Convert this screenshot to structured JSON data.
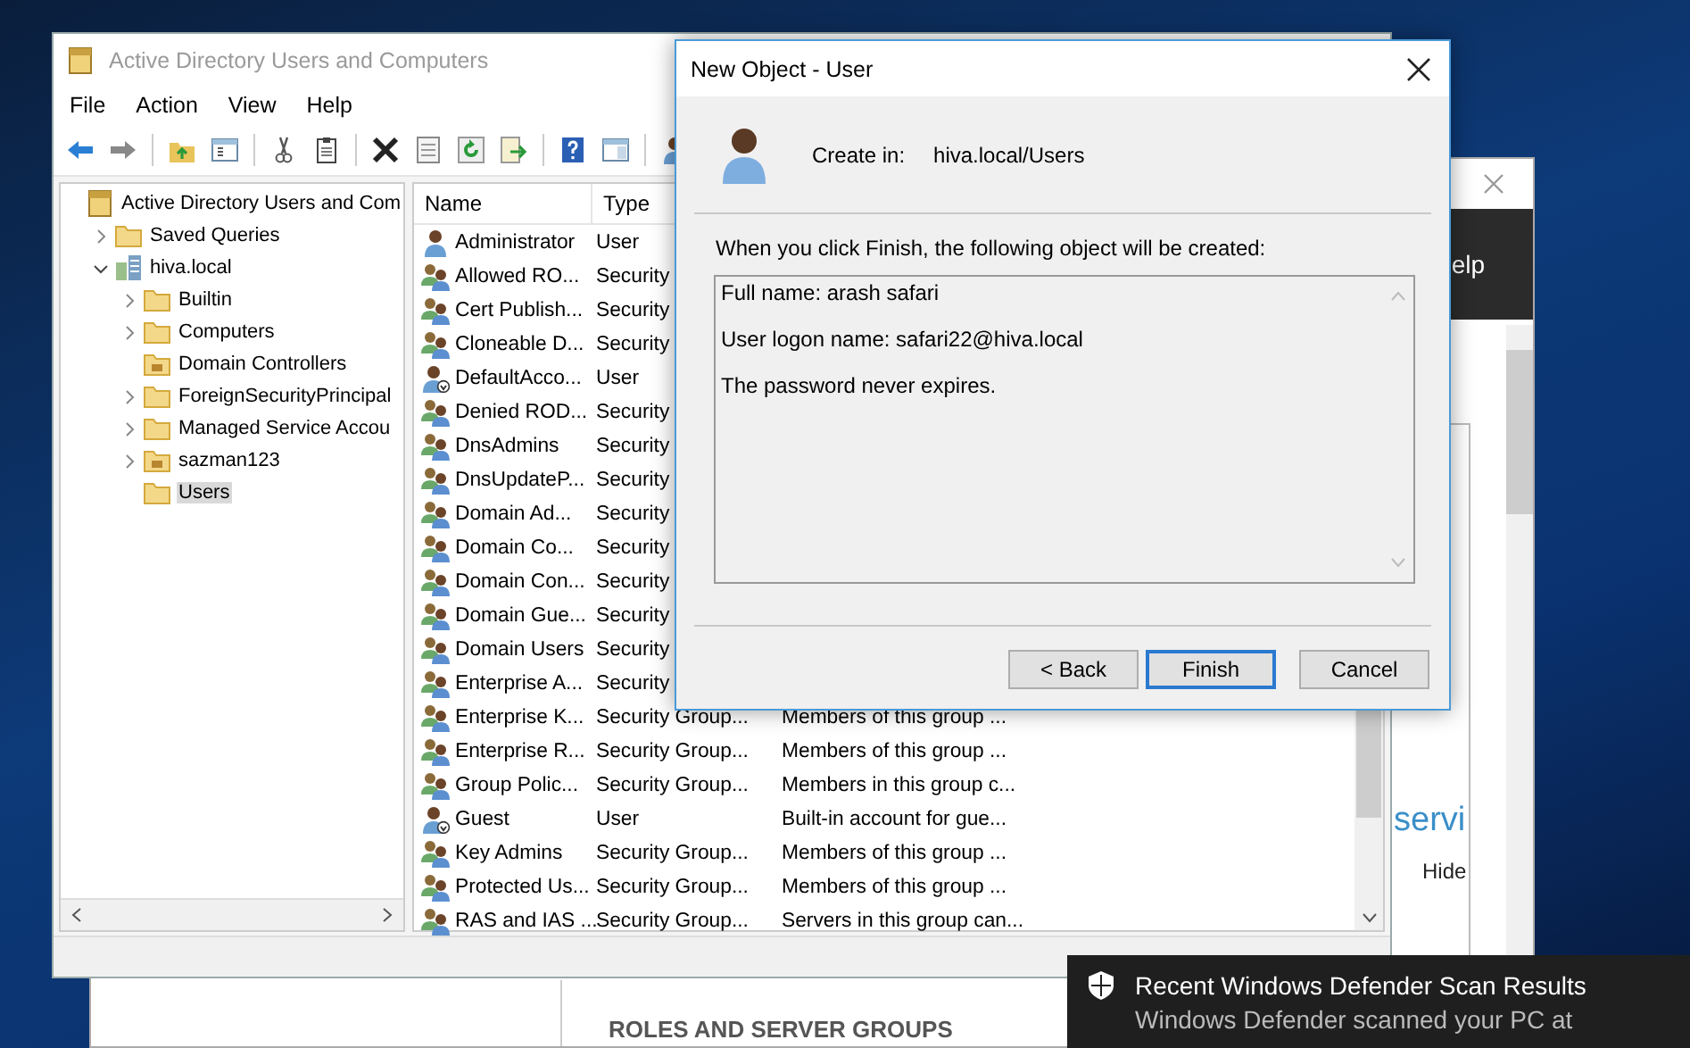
{
  "server_manager": {
    "header_text": "elp",
    "tile_title": "servi",
    "tile_link": "Hide",
    "section_heading": "ROLES AND SERVER GROUPS"
  },
  "main_window": {
    "title": "Active Directory Users and Computers",
    "menu": [
      "File",
      "Action",
      "View",
      "Help"
    ],
    "tree": [
      {
        "label": "Active Directory Users and Com",
        "kind": "snapin",
        "expandable": false,
        "selected": false,
        "children": [
          {
            "label": "Saved Queries",
            "kind": "folder",
            "expandable": true,
            "expanded": false,
            "selected": false
          },
          {
            "label": "hiva.local",
            "kind": "domain",
            "expandable": true,
            "expanded": true,
            "selected": false,
            "children": [
              {
                "label": "Builtin",
                "kind": "folder",
                "expandable": true,
                "expanded": false,
                "selected": false
              },
              {
                "label": "Computers",
                "kind": "folder",
                "expandable": true,
                "expanded": false,
                "selected": false
              },
              {
                "label": "Domain Controllers",
                "kind": "ou",
                "expandable": false,
                "selected": false
              },
              {
                "label": "ForeignSecurityPrincipal",
                "kind": "folder",
                "expandable": true,
                "expanded": false,
                "selected": false
              },
              {
                "label": "Managed Service Accou",
                "kind": "folder",
                "expandable": true,
                "expanded": false,
                "selected": false
              },
              {
                "label": "sazman123",
                "kind": "ou",
                "expandable": true,
                "expanded": false,
                "selected": false
              },
              {
                "label": "Users",
                "kind": "folder",
                "expandable": false,
                "selected": true
              }
            ]
          }
        ]
      }
    ],
    "list": {
      "columns": [
        "Name",
        "Type"
      ],
      "rows": [
        {
          "kind": "user",
          "name": "Administrator",
          "type": "User"
        },
        {
          "kind": "group",
          "name": "Allowed RO...",
          "type": "Security"
        },
        {
          "kind": "group",
          "name": "Cert Publish...",
          "type": "Security"
        },
        {
          "kind": "group",
          "name": "Cloneable D...",
          "type": "Security"
        },
        {
          "kind": "disabled_user",
          "name": "DefaultAcco...",
          "type": "User"
        },
        {
          "kind": "group",
          "name": "Denied ROD...",
          "type": "Security"
        },
        {
          "kind": "group",
          "name": "DnsAdmins",
          "type": "Security"
        },
        {
          "kind": "group",
          "name": "DnsUpdateP...",
          "type": "Security"
        },
        {
          "kind": "group",
          "name": "Domain Ad...",
          "type": "Security"
        },
        {
          "kind": "group",
          "name": "Domain Co...",
          "type": "Security"
        },
        {
          "kind": "group",
          "name": "Domain Con...",
          "type": "Security"
        },
        {
          "kind": "group",
          "name": "Domain Gue...",
          "type": "Security"
        },
        {
          "kind": "group",
          "name": "Domain Users",
          "type": "Security"
        },
        {
          "kind": "group",
          "name": "Enterprise A...",
          "type": "Security"
        },
        {
          "kind": "group",
          "name": "Enterprise K...",
          "type": "Security Group...",
          "description": "Members of this group ..."
        },
        {
          "kind": "group",
          "name": "Enterprise R...",
          "type": "Security Group...",
          "description": "Members of this group ..."
        },
        {
          "kind": "group",
          "name": "Group Polic...",
          "type": "Security Group...",
          "description": "Members in this group c..."
        },
        {
          "kind": "disabled_user",
          "name": "Guest",
          "type": "User",
          "description": "Built-in account for gue..."
        },
        {
          "kind": "group",
          "name": "Key Admins",
          "type": "Security Group...",
          "description": "Members of this group ..."
        },
        {
          "kind": "group",
          "name": "Protected Us...",
          "type": "Security Group...",
          "description": "Members of this group ..."
        },
        {
          "kind": "group",
          "name": "RAS and IAS ...",
          "type": "Security Group...",
          "description": "Servers in this group can..."
        }
      ]
    }
  },
  "dialog": {
    "title": "New Object - User",
    "create_in_label": "Create in:",
    "create_in_value": "hiva.local/Users",
    "summary_label": "When you click Finish, the following object will be created:",
    "summary_lines": [
      "Full name: arash safari",
      "User logon name: safari22@hiva.local",
      "The password never expires."
    ],
    "buttons": [
      {
        "label": "< Back",
        "default": false
      },
      {
        "label": "Finish",
        "default": true
      },
      {
        "label": "Cancel",
        "default": false
      }
    ]
  },
  "toast": {
    "title": "Recent Windows Defender Scan Results",
    "body": "Windows Defender scanned your PC at"
  }
}
